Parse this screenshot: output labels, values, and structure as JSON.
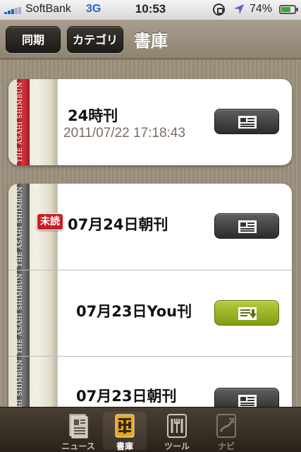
{
  "status_bar": {
    "carrier": "SoftBank",
    "network": "3G",
    "time": "10:53",
    "battery_percent": "74%",
    "battery_level": 0.74
  },
  "nav_bar": {
    "sync_label": "同期",
    "category_label": "カテゴリ",
    "title": "書庫"
  },
  "ribbon_text": "THE ASAHI SHIMBUN",
  "featured": {
    "title": "24時刊",
    "date": "2011/07/22 17:18:43",
    "ribbon_color": "#c9262e",
    "action": "read"
  },
  "issues": [
    {
      "title": "07月24日朝刊",
      "unread_badge": "未読",
      "action": "read"
    },
    {
      "title": "07月23日You刊",
      "action": "download"
    },
    {
      "title": "07月23日朝刊",
      "action": "read"
    }
  ],
  "tab_bar": {
    "tabs": [
      {
        "label": "ニュース",
        "icon": "news-icon",
        "active": false
      },
      {
        "label": "書庫",
        "icon": "library-icon",
        "active": true
      },
      {
        "label": "ツール",
        "icon": "tools-icon",
        "active": false
      },
      {
        "label": "ナビ",
        "icon": "navi-icon",
        "active": false
      }
    ]
  },
  "colors": {
    "download_button": "#9bb82a",
    "read_button": "#3e3e3e",
    "unread_badge": "#c81e25"
  }
}
